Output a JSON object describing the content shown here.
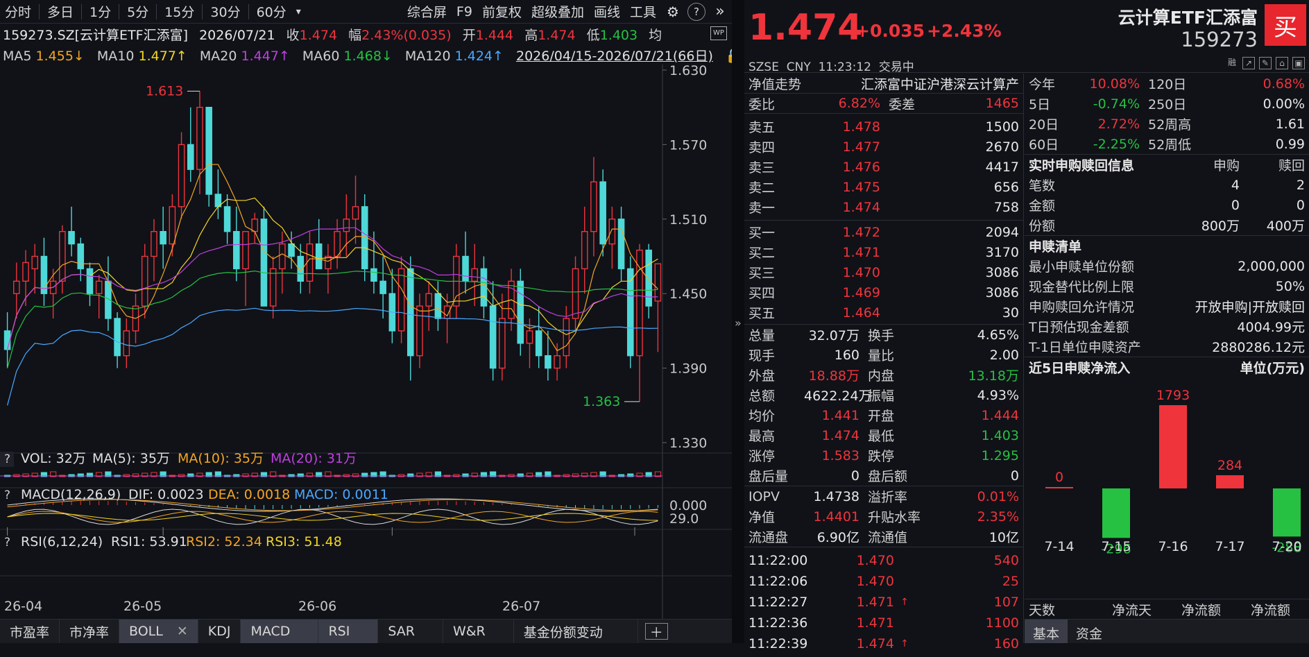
{
  "toolbar": {
    "items": [
      "分时",
      "多日",
      "1分",
      "5分",
      "15分",
      "30分",
      "60分",
      "▾"
    ],
    "right": [
      "综合屏",
      "F9",
      "前复权",
      "超级叠加",
      "画线",
      "工具"
    ]
  },
  "info1": {
    "code": "159273.SZ[云计算ETF汇添富]",
    "date": "2026/07/21",
    "close_label": "收",
    "close": "1.474",
    "range_label": "幅",
    "range": "2.43%(0.035)",
    "open_label": "开",
    "open": "1.444",
    "high_label": "高",
    "high": "1.474",
    "low_label": "低",
    "low": "1.403",
    "avg_label": "均"
  },
  "info2": {
    "ma5": "MA5",
    "ma5v": "1.455↓",
    "ma10": "MA10",
    "ma10v": "1.477↑",
    "ma20": "MA20",
    "ma20v": "1.447↑",
    "ma60": "MA60",
    "ma60v": "1.468↓",
    "ma120": "MA120",
    "ma120v": "1.424↑",
    "period": "2026/04/15-2026/07/21(66日)"
  },
  "chart_data": {
    "type": "candlestick",
    "yticks": [
      "1.630",
      "1.570",
      "1.510",
      "1.450",
      "1.390",
      "1.330"
    ],
    "ylim": [
      1.33,
      1.63
    ],
    "high_label": "1.613",
    "low_label": "1.363",
    "xticks": [
      "26-04",
      "26-05",
      "26-06",
      "26-07"
    ],
    "ohlc": [
      [
        1.42,
        1.435,
        1.39,
        1.405
      ],
      [
        1.45,
        1.475,
        1.43,
        1.46
      ],
      [
        1.46,
        1.485,
        1.44,
        1.475
      ],
      [
        1.47,
        1.49,
        1.45,
        1.48
      ],
      [
        1.48,
        1.495,
        1.44,
        1.45
      ],
      [
        1.45,
        1.47,
        1.43,
        1.46
      ],
      [
        1.46,
        1.505,
        1.45,
        1.5
      ],
      [
        1.5,
        1.52,
        1.48,
        1.49
      ],
      [
        1.49,
        1.495,
        1.46,
        1.47
      ],
      [
        1.47,
        1.475,
        1.44,
        1.45
      ],
      [
        1.45,
        1.465,
        1.43,
        1.46
      ],
      [
        1.46,
        1.48,
        1.42,
        1.43
      ],
      [
        1.43,
        1.435,
        1.39,
        1.4
      ],
      [
        1.4,
        1.43,
        1.39,
        1.42
      ],
      [
        1.42,
        1.45,
        1.41,
        1.44
      ],
      [
        1.44,
        1.49,
        1.43,
        1.48
      ],
      [
        1.48,
        1.51,
        1.46,
        1.5
      ],
      [
        1.5,
        1.52,
        1.47,
        1.49
      ],
      [
        1.49,
        1.53,
        1.48,
        1.52
      ],
      [
        1.52,
        1.58,
        1.51,
        1.57
      ],
      [
        1.57,
        1.6,
        1.54,
        1.55
      ],
      [
        1.55,
        1.613,
        1.53,
        1.6
      ],
      [
        1.6,
        1.6,
        1.52,
        1.53
      ],
      [
        1.53,
        1.55,
        1.51,
        1.52
      ],
      [
        1.52,
        1.53,
        1.49,
        1.5
      ],
      [
        1.5,
        1.52,
        1.46,
        1.47
      ],
      [
        1.47,
        1.5,
        1.44,
        1.5
      ],
      [
        1.5,
        1.515,
        1.49,
        1.51
      ],
      [
        1.51,
        1.52,
        1.44,
        1.44
      ],
      [
        1.44,
        1.48,
        1.43,
        1.47
      ],
      [
        1.47,
        1.5,
        1.45,
        1.49
      ],
      [
        1.49,
        1.5,
        1.47,
        1.48
      ],
      [
        1.48,
        1.49,
        1.45,
        1.46
      ],
      [
        1.46,
        1.5,
        1.45,
        1.49
      ],
      [
        1.49,
        1.51,
        1.47,
        1.47
      ],
      [
        1.47,
        1.49,
        1.45,
        1.48
      ],
      [
        1.48,
        1.51,
        1.47,
        1.5
      ],
      [
        1.5,
        1.53,
        1.48,
        1.51
      ],
      [
        1.51,
        1.545,
        1.49,
        1.52
      ],
      [
        1.52,
        1.53,
        1.46,
        1.47
      ],
      [
        1.47,
        1.5,
        1.45,
        1.46
      ],
      [
        1.46,
        1.48,
        1.43,
        1.45
      ],
      [
        1.45,
        1.47,
        1.41,
        1.42
      ],
      [
        1.42,
        1.48,
        1.41,
        1.47
      ],
      [
        1.47,
        1.48,
        1.38,
        1.4
      ],
      [
        1.4,
        1.45,
        1.39,
        1.44
      ],
      [
        1.44,
        1.46,
        1.42,
        1.45
      ],
      [
        1.45,
        1.46,
        1.42,
        1.43
      ],
      [
        1.43,
        1.45,
        1.41,
        1.44
      ],
      [
        1.44,
        1.49,
        1.43,
        1.48
      ],
      [
        1.48,
        1.5,
        1.45,
        1.46
      ],
      [
        1.46,
        1.49,
        1.44,
        1.47
      ],
      [
        1.47,
        1.48,
        1.43,
        1.44
      ],
      [
        1.44,
        1.46,
        1.38,
        1.39
      ],
      [
        1.39,
        1.45,
        1.38,
        1.43
      ],
      [
        1.43,
        1.47,
        1.42,
        1.46
      ],
      [
        1.46,
        1.47,
        1.4,
        1.41
      ],
      [
        1.41,
        1.43,
        1.39,
        1.42
      ],
      [
        1.42,
        1.44,
        1.39,
        1.4
      ],
      [
        1.4,
        1.42,
        1.38,
        1.39
      ],
      [
        1.39,
        1.41,
        1.38,
        1.4
      ],
      [
        1.4,
        1.44,
        1.39,
        1.43
      ],
      [
        1.43,
        1.48,
        1.42,
        1.47
      ],
      [
        1.47,
        1.52,
        1.45,
        1.5
      ],
      [
        1.5,
        1.56,
        1.48,
        1.54
      ],
      [
        1.54,
        1.55,
        1.48,
        1.49
      ],
      [
        1.49,
        1.52,
        1.47,
        1.51
      ],
      [
        1.51,
        1.52,
        1.46,
        1.47
      ],
      [
        1.47,
        1.48,
        1.39,
        1.4
      ],
      [
        1.4,
        1.49,
        1.363,
        1.485
      ],
      [
        1.485,
        1.49,
        1.43,
        1.44
      ],
      [
        1.444,
        1.474,
        1.403,
        1.474
      ]
    ],
    "vol": {
      "label": "VOL: 32万",
      "ma5": "MA(5): 35万",
      "ma10": "MA(10): 35万",
      "ma20": "MA(20): 31万"
    },
    "macd": {
      "label": "MACD(12,26,9)",
      "dif": "DIF: 0.0023",
      "dea": "DEA: 0.0018",
      "macd": "MACD: 0.0011",
      "ytick": "0.000"
    },
    "rsi": {
      "label": "RSI(6,12,24)",
      "rsi1": "RSI1: 53.91",
      "rsi2": "RSI2: 52.34",
      "rsi3": "RSI3: 51.48",
      "ytick": "29.0"
    }
  },
  "bottom_tabs": [
    "市盈率",
    "市净率",
    "BOLL",
    "KDJ",
    "MACD",
    "RSI",
    "SAR",
    "W&R",
    "基金份额变动"
  ],
  "quote": {
    "price": "1.474",
    "chg": "+0.035",
    "chgp": "+2.43%",
    "exchange": "SZSE",
    "currency": "CNY",
    "time": "11:23:12",
    "status": "交易中",
    "name": "云计算ETF汇添富",
    "code": "159273",
    "buy": "买"
  },
  "nav_row": {
    "label": "净值走势",
    "value": "汇添富中证沪港深云计算产"
  },
  "weibi": {
    "l1": "委比",
    "v1": "6.82%",
    "l2": "委差",
    "v2": "1465"
  },
  "asks": [
    [
      "卖五",
      "1.478",
      "1500"
    ],
    [
      "卖四",
      "1.477",
      "2670"
    ],
    [
      "卖三",
      "1.476",
      "4417"
    ],
    [
      "卖二",
      "1.475",
      "656"
    ],
    [
      "卖一",
      "1.474",
      "758"
    ]
  ],
  "bids": [
    [
      "买一",
      "1.472",
      "2094"
    ],
    [
      "买二",
      "1.471",
      "3170"
    ],
    [
      "买三",
      "1.470",
      "3086"
    ],
    [
      "买四",
      "1.469",
      "3086"
    ],
    [
      "买五",
      "1.464",
      "30"
    ]
  ],
  "stats": [
    [
      "总量",
      "32.07万",
      "w",
      "换手",
      "4.65%",
      "w"
    ],
    [
      "现手",
      "160",
      "w",
      "量比",
      "2.00",
      "w"
    ],
    [
      "外盘",
      "18.88万",
      "r",
      "内盘",
      "13.18万",
      "g"
    ],
    [
      "总额",
      "4622.24万",
      "w",
      "振幅",
      "4.93%",
      "w"
    ],
    [
      "均价",
      "1.441",
      "r",
      "开盘",
      "1.444",
      "r"
    ],
    [
      "最高",
      "1.474",
      "r",
      "最低",
      "1.403",
      "g"
    ],
    [
      "涨停",
      "1.583",
      "r",
      "跌停",
      "1.295",
      "g"
    ],
    [
      "盘后量",
      "0",
      "w",
      "盘后额",
      "0",
      "w"
    ]
  ],
  "iopv": [
    [
      "IOPV",
      "1.4738",
      "w",
      "溢折率",
      "0.01%",
      "r"
    ],
    [
      "净值",
      "1.4401",
      "r",
      "升贴水率",
      "2.35%",
      "r"
    ],
    [
      "流通盘",
      "6.90亿",
      "w",
      "流通值",
      "10亿",
      "w"
    ]
  ],
  "ticks": [
    [
      "11:22:00",
      "1.470",
      "",
      "540"
    ],
    [
      "11:22:06",
      "1.470",
      "",
      "25"
    ],
    [
      "11:22:27",
      "1.471",
      "↑",
      "107"
    ],
    [
      "11:22:36",
      "1.471",
      "",
      "1100"
    ],
    [
      "11:22:39",
      "1.474",
      "↑",
      "160"
    ]
  ],
  "perf": [
    [
      "今年",
      "10.08%",
      "r",
      "120日",
      "0.68%",
      "r"
    ],
    [
      "5日",
      "-0.74%",
      "g",
      "250日",
      "0.00%",
      "w"
    ],
    [
      "20日",
      "2.72%",
      "r",
      "52周高",
      "1.61",
      "w"
    ],
    [
      "60日",
      "-2.25%",
      "g",
      "52周低",
      "0.99",
      "w"
    ]
  ],
  "realtime": {
    "title": "实时申购赎回信息",
    "h1": "申购",
    "h2": "赎回",
    "rows": [
      [
        "笔数",
        "4",
        "2"
      ],
      [
        "金额",
        "0",
        "0"
      ],
      [
        "份额",
        "800万",
        "400万"
      ]
    ]
  },
  "redeem": {
    "title": "申赎清单",
    "rows": [
      [
        "最小申赎单位份额",
        "2,000,000"
      ],
      [
        "现金替代比例上限",
        "50%"
      ],
      [
        "申购赎回允许情况",
        "开放申购|开放赎回"
      ],
      [
        "T日预估现金差额",
        "4004.99元"
      ],
      [
        "T-1日单位申赎资产",
        "2880286.12元"
      ]
    ]
  },
  "flow": {
    "title": "近5日申赎净流入",
    "unit": "单位(万元)",
    "dates": [
      "7-14",
      "7-15",
      "7-16",
      "7-17",
      "7-20"
    ],
    "values": [
      0,
      -296,
      1793,
      284,
      -288
    ],
    "labels": [
      "0",
      "-296",
      "1793",
      "284",
      "-288"
    ]
  },
  "flow_footer": [
    "天数",
    "净流天",
    "净流额",
    "净流额"
  ],
  "right_tabs": [
    "基本",
    "资金"
  ]
}
